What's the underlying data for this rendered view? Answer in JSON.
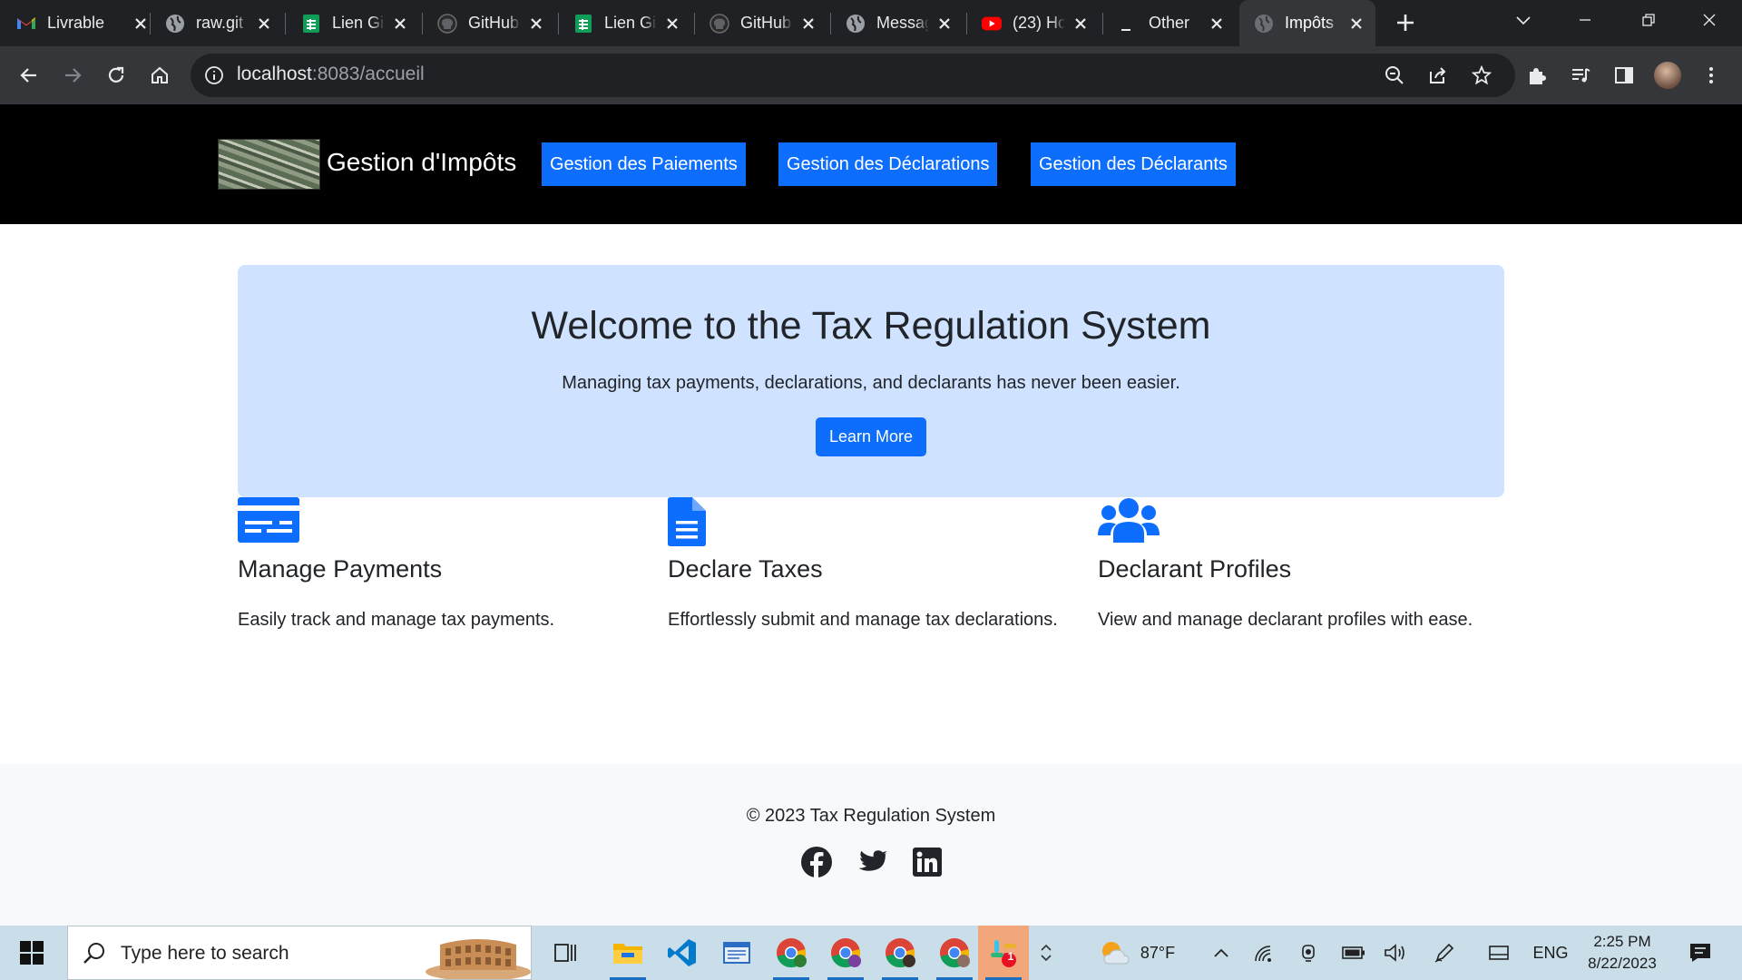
{
  "browser": {
    "tabs": [
      {
        "title": "Livrable",
        "favicon": "gmail-icon"
      },
      {
        "title": "raw.git",
        "favicon": "globe-icon"
      },
      {
        "title": "Lien Gi",
        "favicon": "sheets-icon"
      },
      {
        "title": "GitHub",
        "favicon": "github-icon"
      },
      {
        "title": "Lien Gi",
        "favicon": "sheets-icon"
      },
      {
        "title": "GitHub",
        "favicon": "github-icon"
      },
      {
        "title": "Messag",
        "favicon": "globe-icon"
      },
      {
        "title": "(23) Ho",
        "favicon": "youtube-icon"
      },
      {
        "title": "Other",
        "favicon": "minus-icon"
      },
      {
        "title": "Impôts",
        "favicon": "globe-icon",
        "active": true
      }
    ],
    "url_host": "localhost",
    "url_path": ":8083/accueil"
  },
  "navbar": {
    "brand": "Gestion d'Impôts",
    "links": [
      "Gestion des Paiements",
      "Gestion des Déclarations",
      "Gestion des Déclarants"
    ]
  },
  "hero": {
    "title": "Welcome to the Tax Regulation System",
    "subtitle": "Managing tax payments, declarations, and declarants has never been easier.",
    "button": "Learn More"
  },
  "features": [
    {
      "icon": "credit-card-icon",
      "title": "Manage Payments",
      "text": "Easily track and manage tax payments."
    },
    {
      "icon": "document-icon",
      "title": "Declare Taxes",
      "text": "Effortlessly submit and manage tax declarations."
    },
    {
      "icon": "users-icon",
      "title": "Declarant Profiles",
      "text": "View and manage declarant profiles with ease."
    }
  ],
  "footer": {
    "copyright": "© 2023 Tax Regulation System",
    "social": [
      "facebook-icon",
      "twitter-icon",
      "linkedin-icon"
    ]
  },
  "taskbar": {
    "search_placeholder": "Type here to search",
    "weather": "87°F",
    "language": "ENG",
    "time": "2:25 PM",
    "date": "8/22/2023",
    "slack_badge": "1"
  },
  "colors": {
    "primary": "#0d6efd",
    "hero_bg": "#cfe2ff",
    "navbar_bg": "#000000",
    "footer_bg": "#f8f9fa"
  }
}
